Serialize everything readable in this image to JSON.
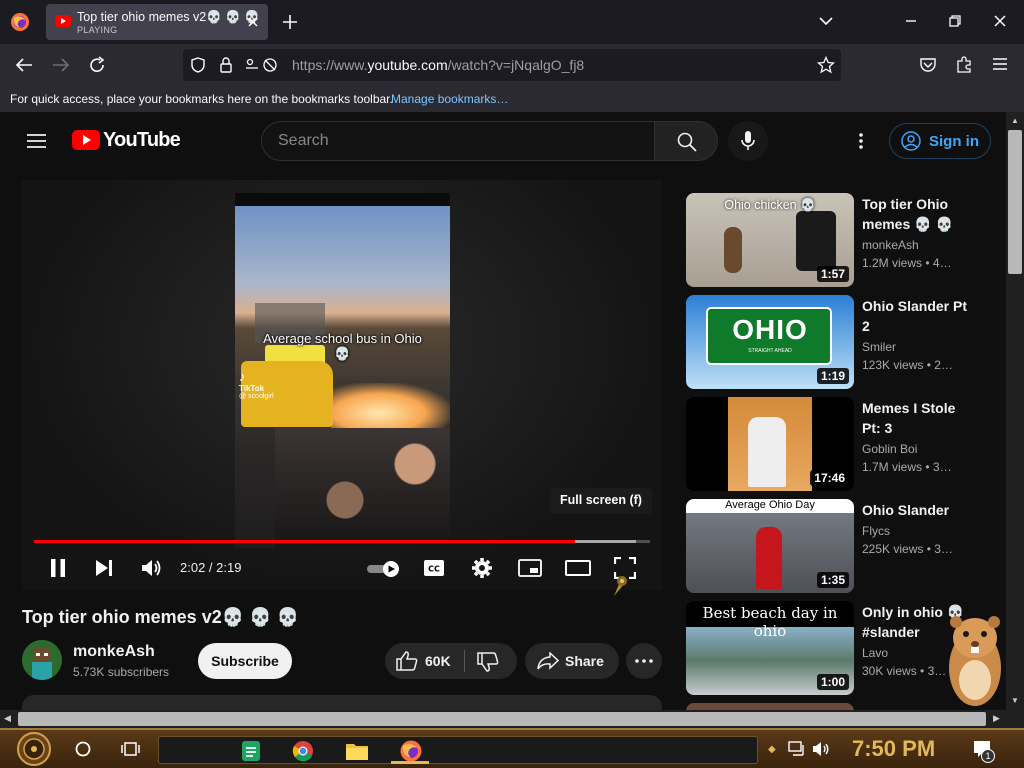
{
  "browser": {
    "tab": {
      "title": "Top tier ohio memes v2💀 💀 💀",
      "status": "PLAYING"
    },
    "url": {
      "prefix": "https://www.",
      "domain": "youtube.com",
      "path": "/watch?v=jNqalgO_fj8"
    },
    "bookmarks": {
      "message": "For quick access, place your bookmarks here on the bookmarks toolbar.",
      "link": "Manage bookmarks…"
    }
  },
  "youtube": {
    "logo_text": "YouTube",
    "search_placeholder": "Search",
    "sign_in": "Sign in",
    "player": {
      "caption": "Average school bus in Ohio",
      "caption_emoji": "💀",
      "watermark": "TikTok",
      "watermark_user": "@ scoolgirl",
      "fullscreen_tooltip": "Full screen (f)",
      "time": "2:02 / 2:19",
      "progress_played": 0.878,
      "progress_buffered": 0.978
    },
    "video": {
      "title": "Top tier ohio memes v2💀 💀 💀",
      "channel": "monkeAsh",
      "subscribers": "5.73K subscribers",
      "subscribe_label": "Subscribe",
      "likes": "60K",
      "share_label": "Share"
    },
    "recommendations": [
      {
        "title": "Top tier Ohio memes 💀 💀",
        "channel": "monkeAsh",
        "views": "1.2M views",
        "age": "• 4…",
        "duration": "1:57",
        "thumb_text": "Ohio chicken 💀"
      },
      {
        "title": "Ohio Slander Pt 2",
        "channel": "Smiler",
        "views": "123K views",
        "age": "• 2…",
        "duration": "1:19",
        "thumb_text": "OHIO",
        "thumb_subtext": "STRAIGHT AHEAD"
      },
      {
        "title": "Memes I Stole Pt: 3",
        "channel": "Goblin Boi",
        "views": "1.7M views",
        "age": "• 3…",
        "duration": "17:46",
        "thumb_text": ""
      },
      {
        "title": "Ohio Slander",
        "channel": "Flycs",
        "views": "225K views",
        "age": "• 3…",
        "duration": "1:35",
        "thumb_text": "Average Ohio Day"
      },
      {
        "title": "Only in ohio 💀 #slander",
        "channel": "Lavo",
        "views": "30K views",
        "age": "• 3…",
        "duration": "1:00",
        "thumb_text": "Best beach day in ohio"
      }
    ]
  },
  "taskbar": {
    "clock": "7:50 PM",
    "notification_count": "1"
  },
  "colors": {
    "accent_red": "#ff0000",
    "link_blue": "#3ea6ff",
    "clock_gold": "#e3b85b"
  }
}
